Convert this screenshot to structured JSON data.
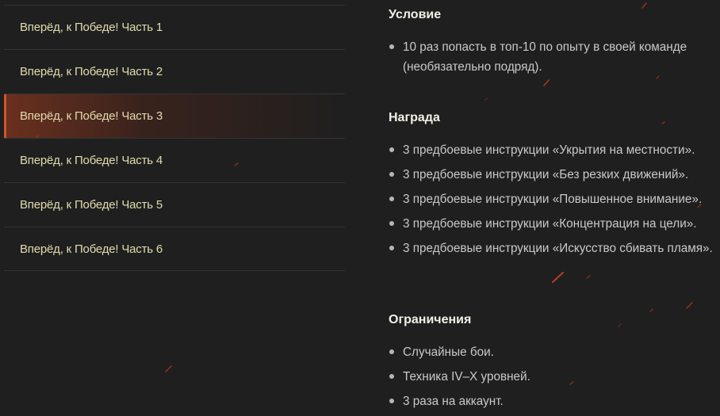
{
  "sidebar": {
    "items": [
      {
        "label": "Вперёд, к Победе! Часть 1"
      },
      {
        "label": "Вперёд, к Победе! Часть 2"
      },
      {
        "label": "Вперёд, к Победе! Часть 3"
      },
      {
        "label": "Вперёд, к Победе! Часть 4"
      },
      {
        "label": "Вперёд, к Победе! Часть 5"
      },
      {
        "label": "Вперёд, к Победе! Часть 6"
      }
    ],
    "active_index": 2
  },
  "content": {
    "condition": {
      "title": "Условие",
      "items": [
        "10 раз попасть в топ-10 по опыту в своей команде (необязательно подряд)."
      ]
    },
    "reward": {
      "title": "Награда",
      "items": [
        "3 предбоевые инструкции «Укрытия на местности».",
        "3 предбоевые инструкции «Без резких движений».",
        "3 предбоевые инструкции «Повышенное внимание».",
        "3 предбоевые инструкции «Концентрация на цели».",
        "3 предбоевые инструкции «Искусство сбивать пламя»."
      ]
    },
    "limits": {
      "title": "Ограничения",
      "items": [
        "Случайные бои.",
        "Техника IV–X уровней.",
        "3 раза на аккаунт."
      ]
    }
  },
  "colors": {
    "background": "#1f1f1f",
    "sidebar_text": "#e2dbae",
    "active_accent": "#d2542b",
    "heading_text": "#f2f0e6",
    "body_text": "#c9c9c9"
  }
}
